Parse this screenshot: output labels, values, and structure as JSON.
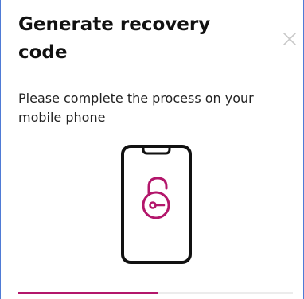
{
  "dialog": {
    "title": "Generate recovery code",
    "message": "Please complete the process on your mobile phone",
    "close_icon": "close-icon",
    "illustration_icon": "phone-lock-icon"
  },
  "progress": {
    "percent": 51
  },
  "colors": {
    "accent": "#b3166b",
    "title_text": "#111111",
    "body_text": "#222222",
    "close_icon": "#c8c8c8",
    "border": "#4f7bd6",
    "phone_outline": "#111111"
  }
}
